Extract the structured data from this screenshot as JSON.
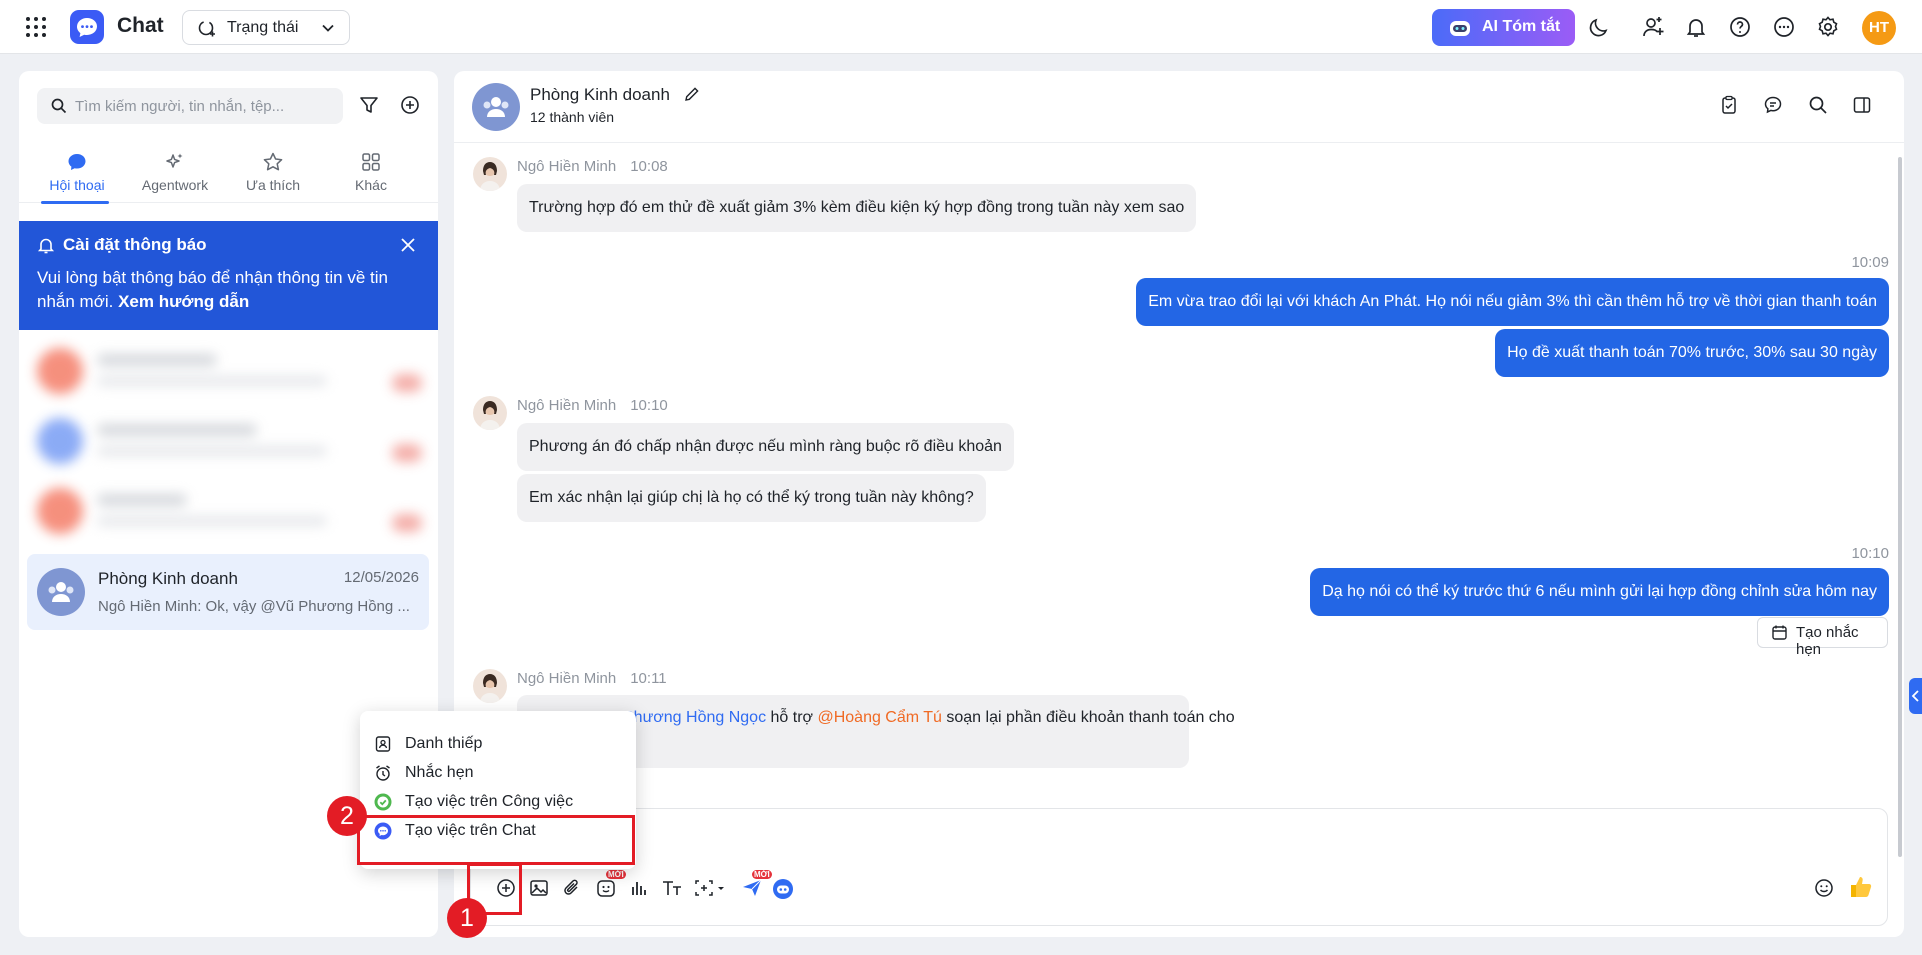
{
  "topbar": {
    "app_name": "Chat",
    "status_label": "Trạng thái",
    "ai_button": "AI Tóm tắt",
    "user_initials": "HT"
  },
  "sidebar": {
    "search_placeholder": "Tìm kiếm người, tin nhắn, tệp...",
    "tabs": [
      {
        "label": "Hội thoại",
        "icon": "chat-bubble-icon",
        "active": true
      },
      {
        "label": "Agentwork",
        "icon": "sparkle-icon",
        "active": false
      },
      {
        "label": "Ưa thích",
        "icon": "star-icon",
        "active": false
      },
      {
        "label": "Khác",
        "icon": "grid-icon",
        "active": false
      }
    ],
    "notice": {
      "title": "Cài đặt thông báo",
      "body": "Vui lòng bật thông báo để nhận thông tin về tin nhắn mới.",
      "link": "Xem hướng dẫn"
    },
    "conversation": {
      "name": "Phòng Kinh doanh",
      "date": "12/05/2026",
      "preview": "Ngô Hiền Minh: Ok, vậy @Vũ Phương Hồng ..."
    }
  },
  "chat": {
    "group_name": "Phòng Kinh doanh",
    "member_count": "12 thành viên",
    "messages": [
      {
        "sender": "Ngô Hiền Minh",
        "time": "10:08",
        "text": "Trường hợp đó em thử đề xuất giảm 3% kèm điều kiện ký hợp đồng trong tuần này xem sao"
      },
      {
        "time": "10:09",
        "text": "Em vừa trao đổi lại với khách An Phát. Họ nói nếu giảm 3% thì cần thêm hỗ trợ về thời gian thanh toán"
      },
      {
        "text": "Họ đề xuất thanh toán 70% trước, 30% sau 30 ngày"
      },
      {
        "sender": "Ngô Hiền Minh",
        "time": "10:10",
        "text": "Phương án đó chấp nhận được nếu mình ràng buộc rõ điều khoản"
      },
      {
        "text": "Em xác nhận lại giúp chị là họ có thể ký trong tuần này không?"
      },
      {
        "time": "10:10",
        "text": "Dạ họ nói có thể ký trước thứ 6 nếu mình gửi lại hợp đồng chỉnh sửa hôm nay"
      },
      {
        "sender": "Ngô Hiền Minh",
        "time": "10:11",
        "mention1": "Phương Hồng Ngọc",
        "mid": " hỗ trợ ",
        "mention2": "@Hoàng Cẩm Tú",
        "tail": " soạn lại phần điều khoản thanh toán cho"
      }
    ],
    "remind_button": "Tạo nhắc hẹn"
  },
  "popup_menu": {
    "items": [
      {
        "label": "Danh thiếp",
        "icon": "contact-card-icon"
      },
      {
        "label": "Nhắc hẹn",
        "icon": "alarm-clock-icon"
      },
      {
        "label": "Tạo việc trên Công việc",
        "icon": "task-check-icon"
      },
      {
        "label": "Tạo việc trên Chat",
        "icon": "chat-task-icon"
      }
    ]
  },
  "annotations": {
    "step1": "1",
    "step2": "2"
  },
  "badges": {
    "new": "MỚI"
  },
  "colors": {
    "primary": "#2f6bf2",
    "outgoing_bubble": "#2366e5",
    "notice_bg": "#2256d8",
    "highlight": "#e31c25",
    "avatar_user": "#f59a14"
  }
}
